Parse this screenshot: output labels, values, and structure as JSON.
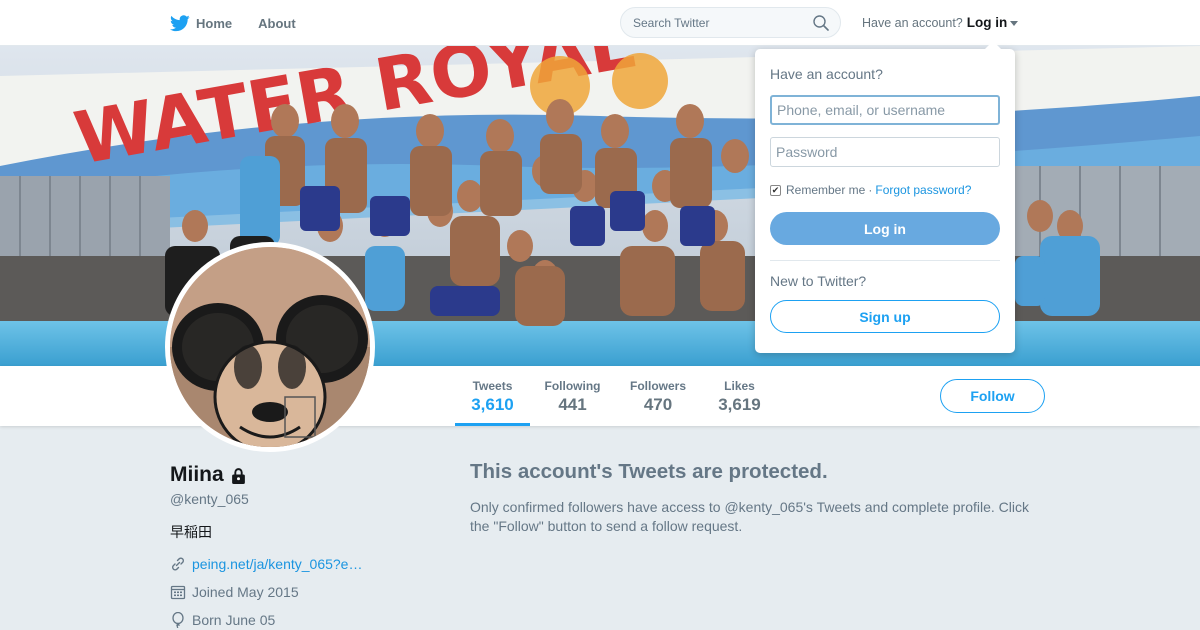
{
  "nav": {
    "home_label": "Home",
    "about_label": "About",
    "search_placeholder": "Search Twitter",
    "have_account_text": "Have an account?",
    "login_label": "Log in",
    "brand_color": "#1da1f2"
  },
  "banner": {
    "painted_text": "WATER ROYAL"
  },
  "profile": {
    "name": "Miina",
    "screen_name": "@kenty_065",
    "bio": "早稲田",
    "link": "peing.net/ja/kenty_065?e…",
    "joined": "Joined May 2015",
    "born": "Born June 05",
    "protected": true
  },
  "stats": [
    {
      "label": "Tweets",
      "value": "3,610",
      "active": true
    },
    {
      "label": "Following",
      "value": "441",
      "active": false
    },
    {
      "label": "Followers",
      "value": "470",
      "active": false
    },
    {
      "label": "Likes",
      "value": "3,619",
      "active": false
    }
  ],
  "follow_label": "Follow",
  "protected_notice": {
    "title": "This account's Tweets are protected.",
    "body": "Only confirmed followers have access to @kenty_065's Tweets and complete profile. Click the \"Follow\" button to send a follow request."
  },
  "login_dropdown": {
    "heading": "Have an account?",
    "username_placeholder": "Phone, email, or username",
    "password_placeholder": "Password",
    "remember_label": "Remember me",
    "separator": "·",
    "forgot_label": "Forgot password?",
    "remember_checked": true,
    "login_button": "Log in",
    "new_to_text": "New to Twitter?",
    "signup_button": "Sign up"
  }
}
